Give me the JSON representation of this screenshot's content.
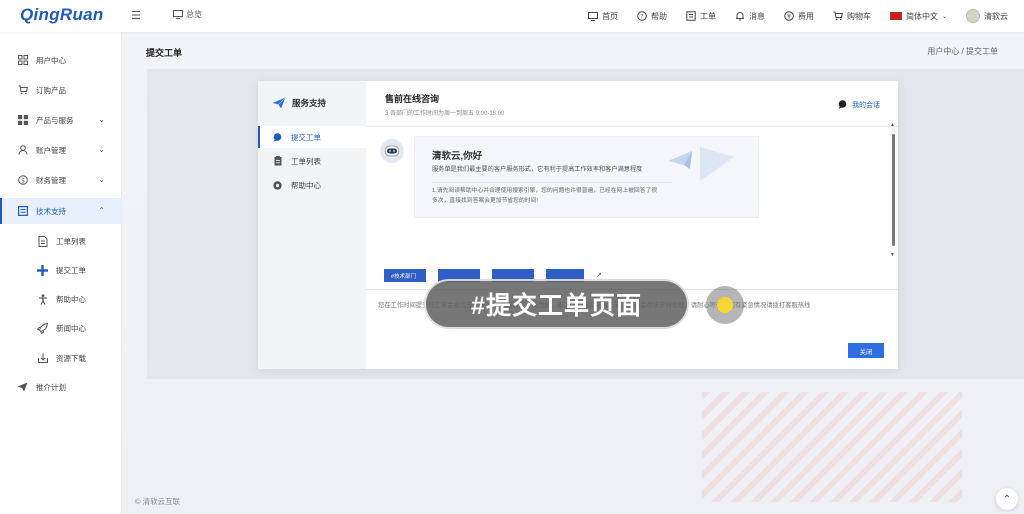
{
  "topbar": {
    "logo": "QingRuan",
    "menu_toggle": "☰",
    "overview": "总览",
    "nav": [
      {
        "icon": "monitor-icon",
        "label": "首页"
      },
      {
        "icon": "help-icon",
        "label": "帮助"
      },
      {
        "icon": "ticket-icon",
        "label": "工单"
      },
      {
        "icon": "bell-icon",
        "label": "消息"
      },
      {
        "icon": "yen-icon",
        "label": "费用"
      },
      {
        "icon": "cart-icon",
        "label": "购物车"
      }
    ],
    "language": "简体中文",
    "user": "清软云"
  },
  "sidebar": {
    "items": [
      {
        "label": "用户中心",
        "icon": "grid-icon"
      },
      {
        "label": "订购产品",
        "icon": "cart-icon"
      },
      {
        "label": "产品与服务",
        "icon": "apps-icon",
        "chevron": "⌄"
      },
      {
        "label": "账户管理",
        "icon": "user-icon",
        "chevron": "⌄"
      },
      {
        "label": "财务管理",
        "icon": "dollar-icon",
        "chevron": "⌄"
      },
      {
        "label": "技术支持",
        "icon": "support-icon",
        "chevron": "⌃"
      },
      {
        "label": "工单列表",
        "icon": "document-icon"
      },
      {
        "label": "提交工单",
        "icon": "plus-icon"
      },
      {
        "label": "帮助中心",
        "icon": "person-icon"
      },
      {
        "label": "新闻中心",
        "icon": "rocket-icon"
      },
      {
        "label": "资源下载",
        "icon": "download-icon"
      },
      {
        "label": "推介计划",
        "icon": "send-icon"
      }
    ]
  },
  "main": {
    "page_title": "提交工单",
    "breadcrumb": "用户中心 / 提交工单",
    "footer": "© 清软云互联"
  },
  "modal": {
    "service_title": "服务支持",
    "menu": [
      "提交工单",
      "工单列表",
      "帮助中心"
    ],
    "chat_title": "售前在线咨询",
    "chat_subtitle": "3 各部门的工作时间为周一到周五 9:00-18:00",
    "my_session": "我的会话",
    "bubble_title": "清软云,你好",
    "bubble_desc": "服务单是我们最主要的客户服务形式，它有利于提高工作效率和客户满意程度",
    "bubble_note": "1.请先阅读帮助中心并合理使用搜索引擎，您的问题也许很普遍，已经在网上被回答了很多次，直接找到答案会更加节省您的时间!",
    "quick_buttons": [
      "#技术部门",
      "",
      "",
      "",
      "↗"
    ],
    "hint": "您在工作时间提交的工单会被优先处理 24小时内客服人员回复，非工作时间提交的工单 我们也会尽快安排处理，请耐心等待，如有紧急情况请拨打客服热线",
    "close_label": "关闭"
  },
  "overlay": {
    "caption": "#提交工单页面"
  }
}
